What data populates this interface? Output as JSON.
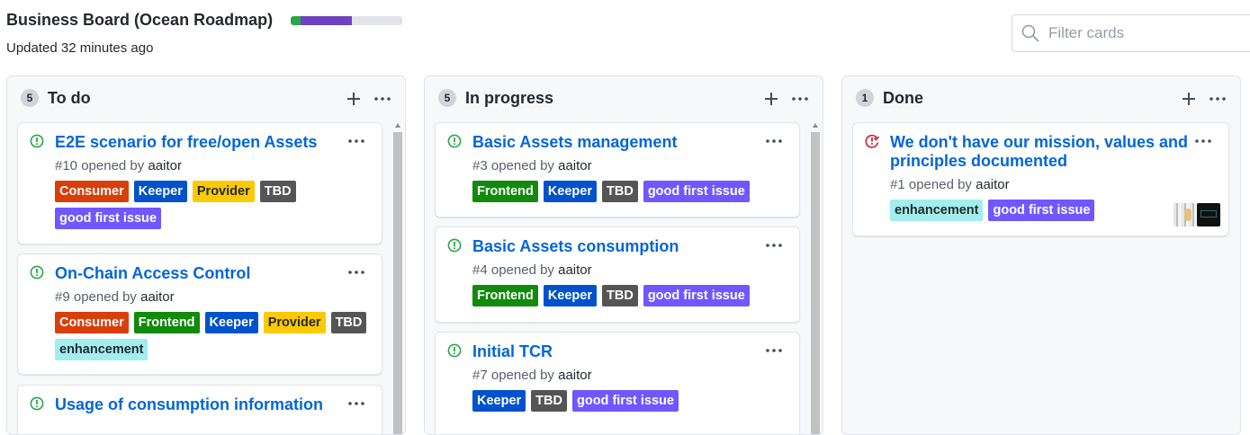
{
  "board": {
    "title": "Business Board (Ocean Roadmap)",
    "updated": "Updated 32 minutes ago",
    "progress": {
      "done_fraction": 0.091,
      "in_progress_fraction": 0.455
    },
    "colors": {
      "done": "#28a745",
      "in_progress": "#6f42c1",
      "remaining": "#e1e4e8"
    }
  },
  "filter": {
    "placeholder": "Filter cards",
    "value": "",
    "icon": "search-icon"
  },
  "label_colors": {
    "Consumer": {
      "bg": "#d93f0b",
      "fg": "#ffffff"
    },
    "Keeper": {
      "bg": "#0052cc",
      "fg": "#ffffff"
    },
    "Provider": {
      "bg": "#fbca04",
      "fg": "#24292e"
    },
    "TBD": {
      "bg": "#555555",
      "fg": "#ffffff"
    },
    "good first issue": {
      "bg": "#7057ff",
      "fg": "#ffffff"
    },
    "Frontend": {
      "bg": "#128a0c",
      "fg": "#ffffff"
    },
    "enhancement": {
      "bg": "#a2eeef",
      "fg": "#24292e"
    }
  },
  "columns": [
    {
      "count": "5",
      "name": "To do",
      "cards": [
        {
          "title": "E2E scenario for free/open Assets",
          "number": "#10",
          "opened_by": "opened by",
          "author": "aaitor",
          "state": "open",
          "labels": [
            "Consumer",
            "Keeper",
            "Provider",
            "TBD",
            "good first issue"
          ]
        },
        {
          "title": "On-Chain Access Control",
          "number": "#9",
          "opened_by": "opened by",
          "author": "aaitor",
          "state": "open",
          "labels": [
            "Consumer",
            "Frontend",
            "Keeper",
            "Provider",
            "TBD",
            "enhancement"
          ]
        },
        {
          "title": "Usage of consumption information",
          "state": "open"
        }
      ]
    },
    {
      "count": "5",
      "name": "In progress",
      "cards": [
        {
          "title": "Basic Assets management",
          "number": "#3",
          "opened_by": "opened by",
          "author": "aaitor",
          "state": "open",
          "labels": [
            "Frontend",
            "Keeper",
            "TBD",
            "good first issue"
          ]
        },
        {
          "title": "Basic Assets consumption",
          "number": "#4",
          "opened_by": "opened by",
          "author": "aaitor",
          "state": "open",
          "labels": [
            "Frontend",
            "Keeper",
            "TBD",
            "good first issue"
          ]
        },
        {
          "title": "Initial TCR",
          "number": "#7",
          "opened_by": "opened by",
          "author": "aaitor",
          "state": "open",
          "labels": [
            "Keeper",
            "TBD",
            "good first issue"
          ]
        }
      ]
    },
    {
      "count": "1",
      "name": "Done",
      "cards": [
        {
          "title": "We don't have our mission, values and principles documented",
          "number": "#1",
          "opened_by": "opened by",
          "author": "aaitor",
          "state": "closed",
          "labels": [
            "enhancement",
            "good first issue"
          ],
          "avatars": [
            "avatar-light",
            "avatar-dark"
          ]
        }
      ]
    }
  ]
}
